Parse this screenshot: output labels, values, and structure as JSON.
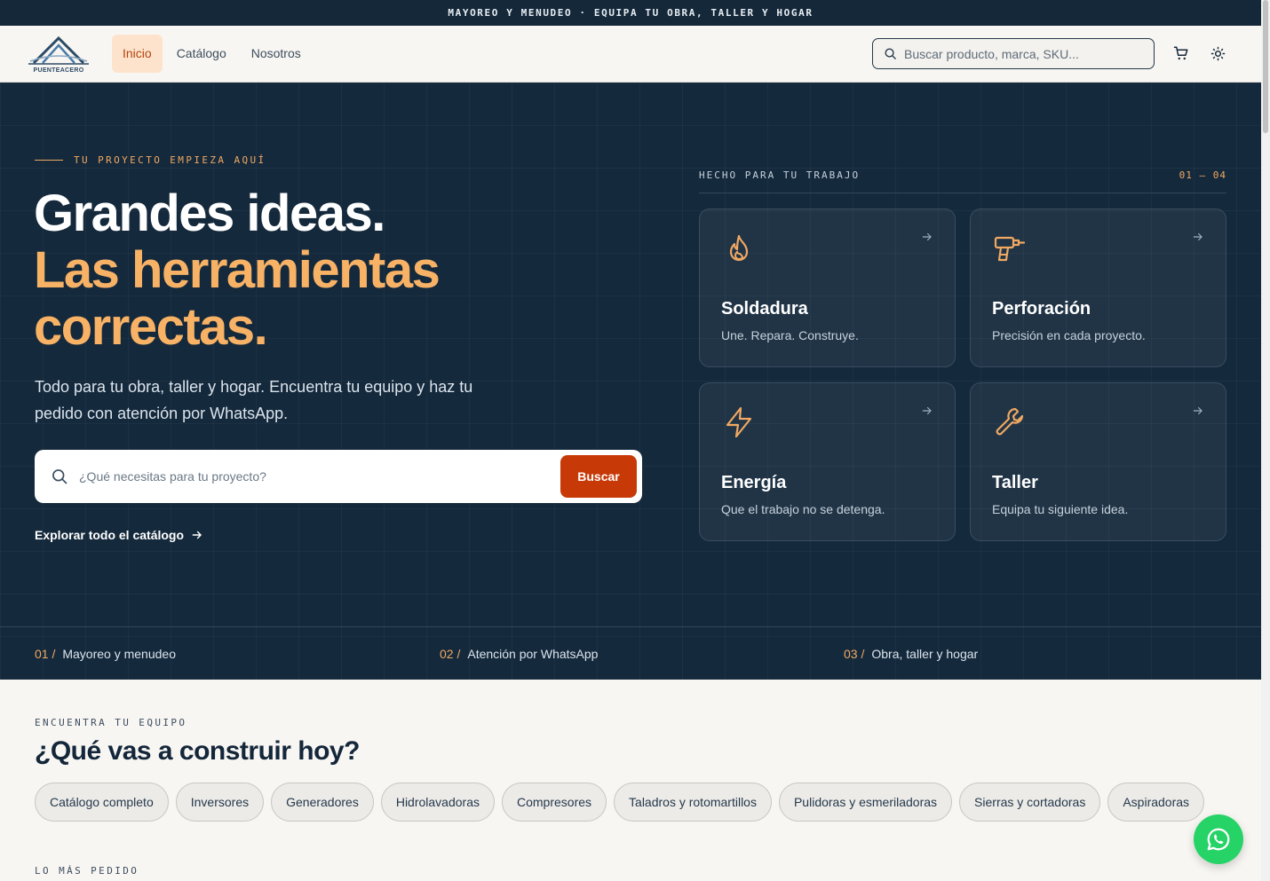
{
  "topbar": {
    "text": "MAYOREO Y MENUDEO · EQUIPA TU OBRA, TALLER Y HOGAR"
  },
  "header": {
    "logo_text": "PUENTEACERO",
    "nav": [
      {
        "label": "Inicio",
        "active": true
      },
      {
        "label": "Catálogo",
        "active": false
      },
      {
        "label": "Nosotros",
        "active": false
      }
    ],
    "search_placeholder": "Buscar producto, marca, SKU...",
    "icons": [
      "cart-icon",
      "theme-toggle-icon"
    ]
  },
  "hero": {
    "eyebrow": "TU PROYECTO EMPIEZA AQUÍ",
    "title_line1": "Grandes ideas.",
    "title_line2": "Las herramientas",
    "title_line3": "correctas.",
    "lead": "Todo para tu obra, taller y hogar. Encuentra tu equipo y haz tu pedido con atención por WhatsApp.",
    "search_placeholder": "¿Qué necesitas para tu proyecto?",
    "search_button": "Buscar",
    "explore_link": "Explorar todo el catálogo",
    "panel_label": "HECHO PARA TU TRABAJO",
    "panel_counter": "01 — 04",
    "cards": [
      {
        "title": "Soldadura",
        "desc": "Une. Repara. Construye.",
        "icon": "flame-icon"
      },
      {
        "title": "Perforación",
        "desc": "Precisión en cada proyecto.",
        "icon": "drill-icon"
      },
      {
        "title": "Energía",
        "desc": "Que el trabajo no se detenga.",
        "icon": "lightning-icon"
      },
      {
        "title": "Taller",
        "desc": "Equipa tu siguiente idea.",
        "icon": "wrench-icon"
      }
    ],
    "features": [
      {
        "num": "01 /",
        "label": "Mayoreo y menudeo"
      },
      {
        "num": "02 /",
        "label": "Atención por WhatsApp"
      },
      {
        "num": "03 /",
        "label": "Obra, taller y hogar"
      }
    ]
  },
  "categories": {
    "eyebrow": "ENCUENTRA TU EQUIPO",
    "title": "¿Qué vas a construir hoy?",
    "chips": [
      "Catálogo completo",
      "Inversores",
      "Generadores",
      "Hidrolavadoras",
      "Compresores",
      "Taladros y rotomartillos",
      "Pulidoras y esmeriladoras",
      "Sierras y cortadoras",
      "Aspiradoras"
    ]
  },
  "popular": {
    "eyebrow": "LO MÁS PEDIDO"
  },
  "colors": {
    "navy": "#14293c",
    "accent": "#f8b266",
    "button": "#c73a08",
    "whatsapp": "#25d366"
  }
}
